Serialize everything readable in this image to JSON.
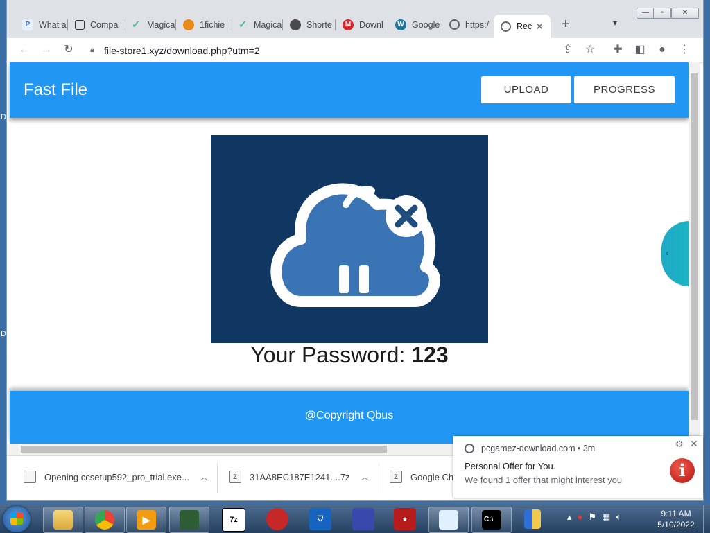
{
  "desktop": {
    "edge_letters": [
      "D",
      "D"
    ]
  },
  "browser": {
    "tabs": [
      {
        "label": "What a",
        "icon": "p-logo-icon",
        "color": "#e8f0fe"
      },
      {
        "label": "Compa",
        "icon": "copy-icon",
        "color": "#ffffff"
      },
      {
        "label": "Magica",
        "icon": "vue-logo-icon",
        "color": "#42b883"
      },
      {
        "label": "1fichie",
        "icon": "orange-fruit-icon",
        "color": "#e98a1b"
      },
      {
        "label": "Magica",
        "icon": "vue-logo-icon",
        "color": "#42b883"
      },
      {
        "label": "Shorte",
        "icon": "ninja-icon",
        "color": "#4a4a4a"
      },
      {
        "label": "Downl",
        "icon": "mega-logo-icon",
        "color": "#d9272e"
      },
      {
        "label": "Google",
        "icon": "wordpress-icon",
        "color": "#21759b"
      },
      {
        "label": "https:/",
        "icon": "globe-icon",
        "color": "#5f6368"
      },
      {
        "label": "Rec",
        "icon": "globe-icon",
        "color": "#5f6368",
        "active": true
      }
    ],
    "new_tab": "+",
    "address": "file-store1.xyz/download.php?utm=2"
  },
  "page": {
    "site_title": "Fast File",
    "nav": {
      "upload": "UPLOAD",
      "progress": "PROGRESS"
    },
    "password_label": "Your Password:",
    "password_value": "123",
    "footer": "@Copyright Qbus",
    "side_tab_arrow": "‹",
    "colors": {
      "header": "#2196f3",
      "hero": "#0f3762",
      "cloud": "#3a74b5"
    }
  },
  "downloads": [
    {
      "label": "Opening ccsetup592_pro_trial.exe..."
    },
    {
      "label": "31AA8EC187E1241....7z"
    },
    {
      "label": "Google Ch"
    }
  ],
  "notification": {
    "origin": "pcgamez-download.com",
    "age": "3m",
    "title": "Personal Offer for You.",
    "body": "We found 1 offer that might interest you"
  },
  "taskbar": {
    "apps": [
      "file-explorer",
      "chrome",
      "media-player",
      "task-manager",
      "7-zip",
      "app-red",
      "vpn-shield",
      "image-app",
      "screen-recorder",
      "notepad",
      "command-prompt",
      "security-shield"
    ],
    "seven_zip_label": "7z",
    "clock_time": "9:11 AM",
    "clock_date": "5/10/2022"
  }
}
